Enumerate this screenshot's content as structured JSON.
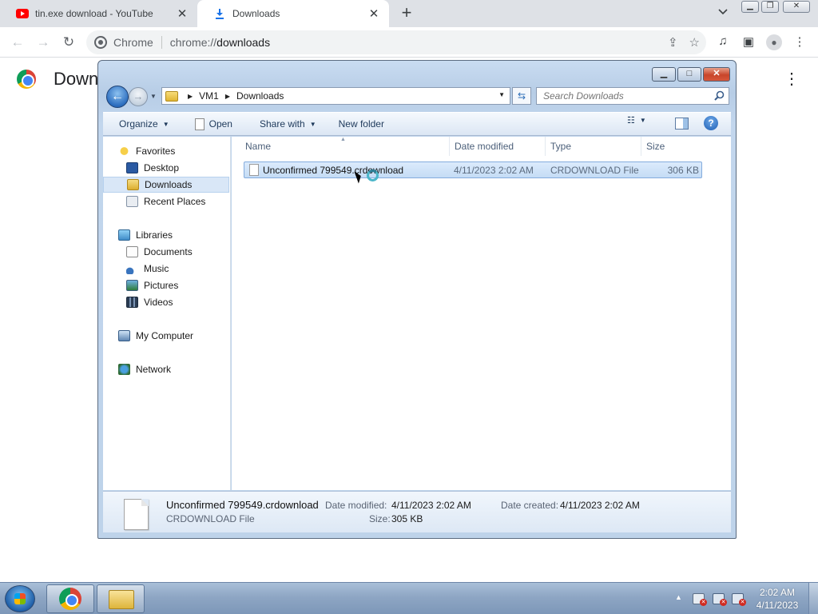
{
  "browser": {
    "tabs": [
      {
        "title": "tin.exe download - YouTube",
        "icon": "youtube-icon",
        "active": false
      },
      {
        "title": "Downloads",
        "icon": "download-icon",
        "active": true
      }
    ],
    "omnibox": {
      "chip": "Chrome",
      "url_scheme": "chrome://",
      "url_host": "downloads"
    },
    "page_title": "Down"
  },
  "explorer": {
    "breadcrumbs": [
      "VM1",
      "Downloads"
    ],
    "search_placeholder": "Search Downloads",
    "commands": {
      "organize": "Organize",
      "open": "Open",
      "share_with": "Share with",
      "new_folder": "New folder"
    },
    "nav": {
      "favorites": "Favorites",
      "favorites_items": [
        "Desktop",
        "Downloads",
        "Recent Places"
      ],
      "libraries": "Libraries",
      "libraries_items": [
        "Documents",
        "Music",
        "Pictures",
        "Videos"
      ],
      "computer": "My Computer",
      "network": "Network",
      "selected": "Downloads"
    },
    "columns": {
      "name": "Name",
      "date": "Date modified",
      "type": "Type",
      "size": "Size"
    },
    "files": [
      {
        "name": "Unconfirmed 799549.crdownload",
        "date": "4/11/2023 2:02 AM",
        "type": "CRDOWNLOAD File",
        "size": "306 KB",
        "selected": true
      }
    ],
    "details": {
      "name": "Unconfirmed 799549.crdownload",
      "type": "CRDOWNLOAD File",
      "modified_label": "Date modified:",
      "modified_value": "4/11/2023 2:02 AM",
      "size_label": "Size:",
      "size_value": "305 KB",
      "created_label": "Date created:",
      "created_value": "4/11/2023 2:02 AM"
    }
  },
  "taskbar": {
    "pinned": [
      "chrome-icon",
      "windows-explorer-icon"
    ],
    "clock_time": "2:02 AM",
    "clock_date": "4/11/2023"
  },
  "colors": {
    "selection": "#cce0f7",
    "explorer_frame": "#bed3ea",
    "taskbar": "#8ea6c4",
    "chrome_tabstrip": "#dee1e6"
  }
}
